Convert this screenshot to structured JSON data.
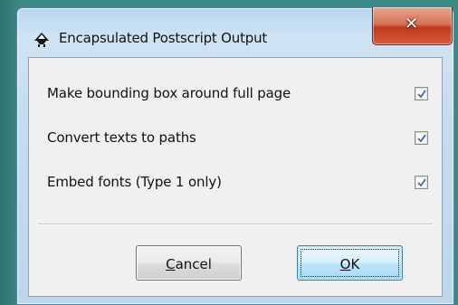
{
  "window": {
    "title": "Encapsulated Postscript Output",
    "close_glyph": "✕",
    "app_icon": "inkscape-icon"
  },
  "options": [
    {
      "label": "Make bounding box around full page",
      "checked": true
    },
    {
      "label": "Convert texts to paths",
      "checked": true
    },
    {
      "label": "Embed fonts (Type 1 only)",
      "checked": true
    }
  ],
  "buttons": {
    "cancel": {
      "mnemonic": "C",
      "rest": "ancel"
    },
    "ok": {
      "mnemonic": "O",
      "rest": "K"
    }
  },
  "colors": {
    "background": "#3b8a85",
    "close_button": "#c0391e",
    "checkmark": "#4a64a8",
    "default_button_border": "#3c7fb1"
  }
}
